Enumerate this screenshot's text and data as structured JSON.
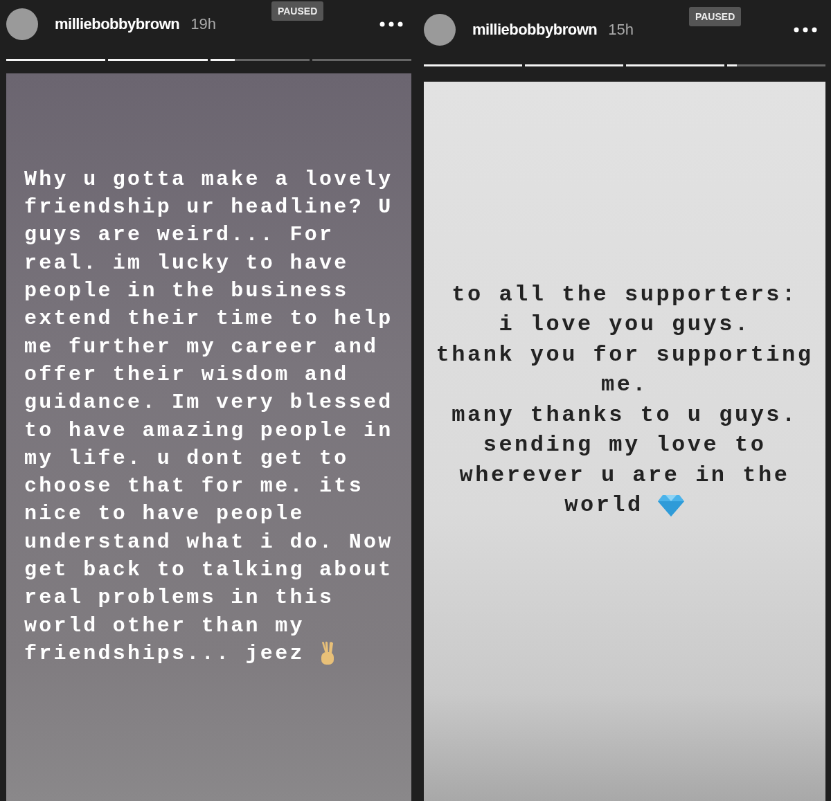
{
  "stories": [
    {
      "username": "milliebobbybrown",
      "time": "19h",
      "badge": "PAUSED",
      "progress": [
        {
          "level": 1
        },
        {
          "level": 1
        },
        {
          "level": 0.25
        },
        {
          "level": 0
        }
      ],
      "lines": [
        "Why u gotta make a lovely",
        "friendship ur headline? U",
        "guys are weird... For",
        "real. im lucky to have",
        "people in the business",
        "extend their time to help",
        "me further my career and",
        "offer their wisdom and",
        "guidance. Im very blessed",
        "to have amazing people in",
        "my life. u dont get to",
        "choose that for me. its",
        "nice to have people",
        "understand what i do. Now",
        "get back to talking about",
        "real problems in this",
        "world other than my",
        "friendships... jeez"
      ]
    },
    {
      "username": "milliebobbybrown",
      "time": "15h",
      "badge": "PAUSED",
      "progress": [
        {
          "level": 1
        },
        {
          "level": 1
        },
        {
          "level": 1
        },
        {
          "level": 0.1
        }
      ],
      "lines": [
        "to all the supporters:",
        "i love you guys.",
        "thank you for supporting",
        "me.",
        "many thanks to u guys.",
        "sending my love to",
        "wherever u are in the",
        "world"
      ]
    }
  ]
}
